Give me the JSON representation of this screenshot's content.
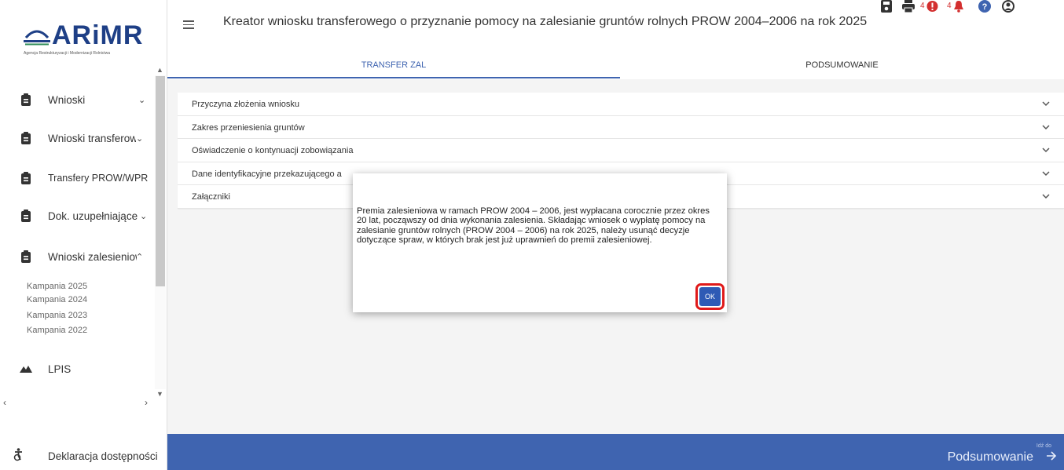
{
  "brand": {
    "name": "ARiMR",
    "subtitle": "Agencja Restrukturyzacji i Modernizacji Rolnictwa"
  },
  "header": {
    "title": "Kreator wniosku transferowego o przyznanie pomocy na zalesianie gruntów rolnych PROW 2004–2006 na rok 2025",
    "error_count": "4",
    "notification_count": "4",
    "icons": [
      "save-icon",
      "print-icon",
      "error-icon",
      "bell-icon",
      "help-icon",
      "account-icon"
    ],
    "colors": {
      "error": "#d32f2f",
      "accent": "#3f64b0"
    }
  },
  "tabs": [
    {
      "label": "TRANSFER ZAL",
      "active": true
    },
    {
      "label": "PODSUMOWANIE",
      "active": false
    }
  ],
  "sidebar": {
    "items": [
      {
        "label": "Wnioski",
        "icon": "clipboard-icon",
        "chevron": "down"
      },
      {
        "label": "Wnioski transferowe",
        "icon": "clipboard-icon",
        "chevron": "down"
      },
      {
        "label": "Transfery PROW/WPR",
        "icon": "clipboard-icon",
        "chevron": ""
      },
      {
        "label": "Dok. uzupełniające",
        "icon": "clipboard-icon",
        "chevron": "down"
      },
      {
        "label": "Wnioski zalesieniowe",
        "icon": "clipboard-icon",
        "chevron": "up"
      }
    ],
    "sub_items": [
      "Kampania 2025",
      "Kampania 2024",
      "Kampania 2023",
      "Kampania 2022"
    ],
    "lpis": {
      "label": "LPIS",
      "icon": "mountain-icon"
    },
    "declaration": {
      "label": "Deklaracja dostępności",
      "icon": "accessibility-icon"
    }
  },
  "accordion": [
    "Przyczyna złożenia wniosku",
    "Zakres przeniesienia gruntów",
    "Oświadczenie o kontynuacji zobowiązania",
    "Dane identyfikacyjne przekazującego a",
    "Załączniki"
  ],
  "dialog": {
    "message": "Premia zalesieniowa w ramach PROW 2004 – 2006, jest wypłacana corocznie przez okres 20 lat, począwszy od dnia wykonania zalesienia. Składając wniosek o wypłatę pomocy na zalesianie gruntów rolnych (PROW 2004 – 2006) na rok 2025, należy usunąć decyzje dotyczące spraw, w których brak jest już uprawnień do premii zalesieniowej.",
    "ok_label": "OK"
  },
  "footer": {
    "small": "Idź do",
    "big": "Podsumowanie"
  }
}
